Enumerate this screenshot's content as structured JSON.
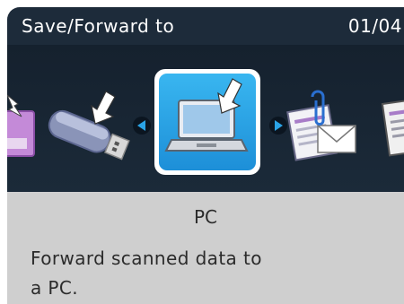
{
  "header": {
    "title": "Save/Forward to",
    "page_indicator": "01/04"
  },
  "carousel": {
    "items": [
      {
        "icon": "memory-card-icon",
        "selected": false
      },
      {
        "icon": "usb-flash-drive-icon",
        "selected": false
      },
      {
        "icon": "pc-laptop-icon",
        "selected": true
      },
      {
        "icon": "email-attachment-icon",
        "selected": false
      },
      {
        "icon": "network-folder-icon",
        "selected": false
      }
    ],
    "prev_icon": "left-arrow-icon",
    "next_icon": "right-arrow-icon"
  },
  "selected_item": {
    "name": "PC",
    "description_line1": "Forward scanned data to",
    "description_line2": "a PC."
  },
  "colors": {
    "header_bg": "#1d2b3a",
    "selection_blue": "#2aa3e6",
    "info_bg": "#cfcfcf"
  }
}
